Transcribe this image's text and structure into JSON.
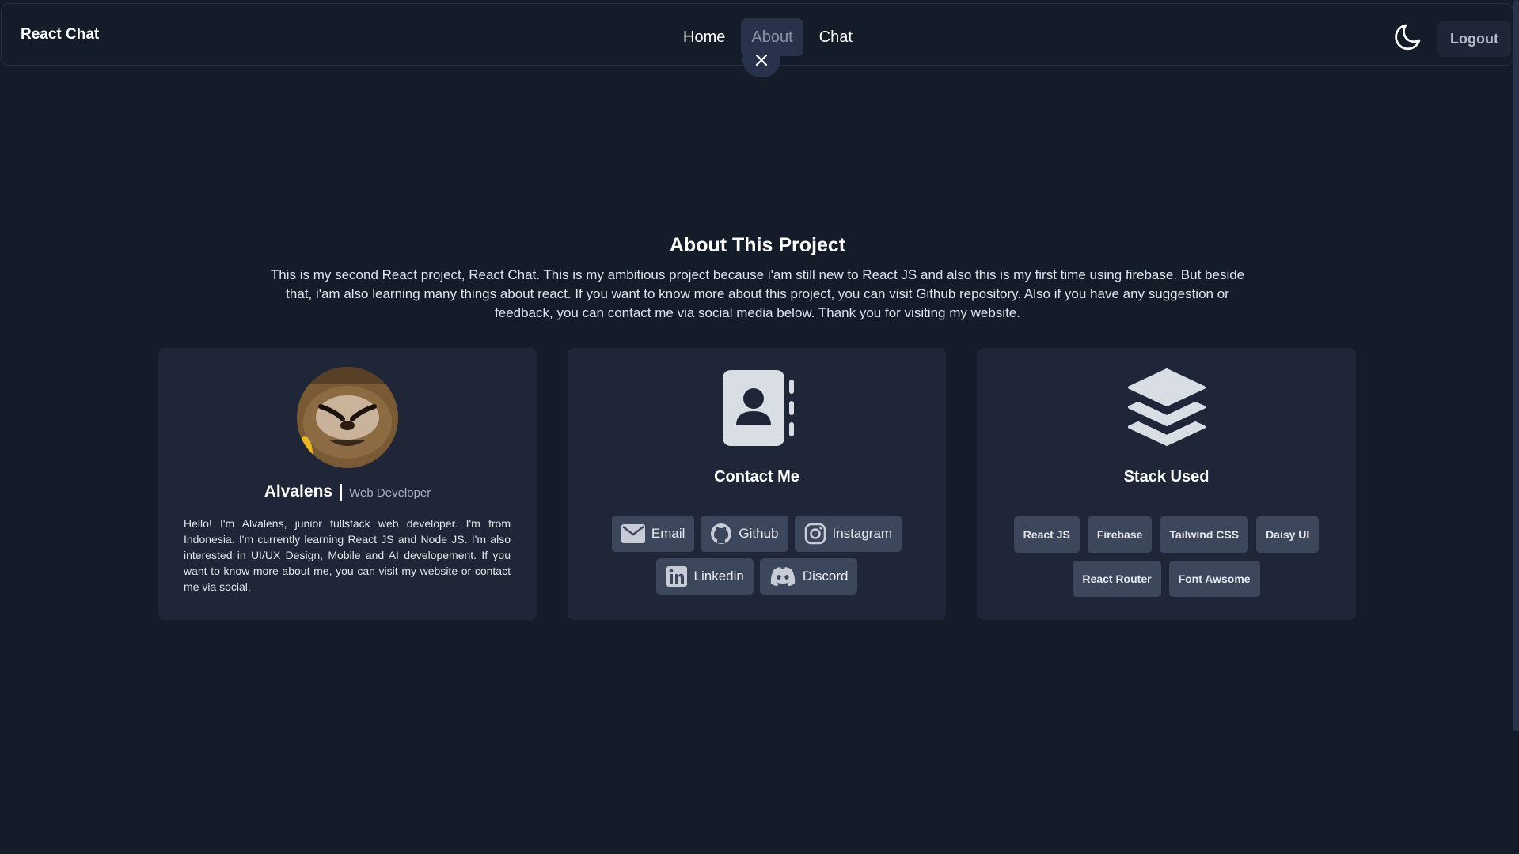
{
  "navbar": {
    "brand": "React Chat",
    "links": [
      {
        "label": "Home",
        "active": false
      },
      {
        "label": "About",
        "active": true
      },
      {
        "label": "Chat",
        "active": false
      }
    ],
    "logout_label": "Logout",
    "icons": {
      "theme": "moon-icon",
      "close": "close-icon"
    }
  },
  "about": {
    "title": "About This Project",
    "description": "This is my second React project, React Chat. This is my ambitious project because i'am still new to React JS and also this is my first time using firebase. But beside that, i'am also learning many things about react. If you want to know more about this project, you can visit Github repository. Also if you have any suggestion or feedback, you can contact me via social media below. Thank you for visiting my website."
  },
  "profile": {
    "name": "Alvalens",
    "separator": "|",
    "role": "Web Developer",
    "bio": "Hello! I'm Alvalens, junior fullstack web developer. I'm from Indonesia. I'm currently learning React JS and Node JS. I'm also interested in UI/UX Design, Mobile and AI developement. If you want to know more about me, you can visit my website or contact me via social."
  },
  "contact": {
    "title": "Contact Me",
    "icon": "address-book-icon",
    "buttons": [
      {
        "label": "Email",
        "icon": "envelope-icon"
      },
      {
        "label": "Github",
        "icon": "github-icon"
      },
      {
        "label": "Instagram",
        "icon": "instagram-icon"
      },
      {
        "label": "Linkedin",
        "icon": "linkedin-icon"
      },
      {
        "label": "Discord",
        "icon": "discord-icon"
      }
    ]
  },
  "stack": {
    "title": "Stack Used",
    "icon": "layers-icon",
    "items": [
      "React JS",
      "Firebase",
      "Tailwind CSS",
      "Daisy UI",
      "React Router",
      "Font Awsome"
    ]
  },
  "colors": {
    "background": "#141b29",
    "card": "#1e2637",
    "badge": "#3d475b",
    "active_nav": "#28324a"
  }
}
